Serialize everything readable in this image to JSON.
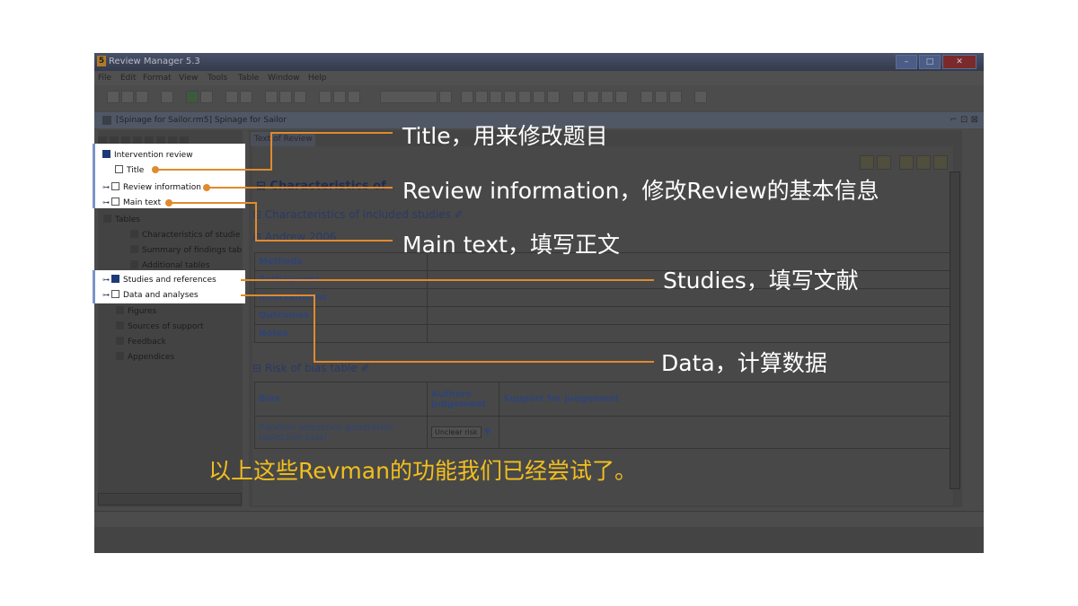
{
  "window": {
    "title": "Review Manager 5.3",
    "app_icon": "5"
  },
  "menu": [
    "File",
    "Edit",
    "Format",
    "View",
    "Tools",
    "Table",
    "Window",
    "Help"
  ],
  "document": {
    "tab_title": "[Spinage for Sailor.rm5] Spinage for Sailor",
    "controls": "⌐ ⊡ ⊠"
  },
  "tree": {
    "items": [
      {
        "label": "Intervention review"
      },
      {
        "label": "Title"
      },
      {
        "label": "Review information"
      },
      {
        "label": "Main text"
      },
      {
        "label": "Tables"
      },
      {
        "label": "Characteristics of studie"
      },
      {
        "label": "Summary of findings tab"
      },
      {
        "label": "Additional tables"
      },
      {
        "label": "Studies and references"
      },
      {
        "label": "Data and analyses"
      },
      {
        "label": "Figures"
      },
      {
        "label": "Sources of support"
      },
      {
        "label": "Feedback"
      },
      {
        "label": "Appendices"
      }
    ]
  },
  "main": {
    "tab_label": "Text of Review",
    "heading1": "Characteristics of",
    "heading2": "Characteristics of included studies",
    "heading3": "Andrew 2006",
    "study_rows": [
      "Methods",
      "Participants",
      "Interventions",
      "Outcomes",
      "Notes"
    ],
    "rob_heading": "Risk of bias table",
    "rob_headers": [
      "Bias",
      "Authors' judgement",
      "Support for judgement"
    ],
    "rob_row1": "Random sequence generation (selection bias)",
    "rob_value": "Unclear risk"
  },
  "callouts": {
    "title": "Title，用来修改题目",
    "review_info": "Review information，修改Review的基本信息",
    "main_text": "Main text，填写正文",
    "studies": "Studies，填写文献",
    "data": "Data，计算数据"
  },
  "conclusion": "以上这些Revman的功能我们已经尝试了。",
  "colors": {
    "accent_line": "#e08a2e",
    "conclusion_text": "#f2bf1e",
    "highlight_border": "#7a96c8"
  }
}
